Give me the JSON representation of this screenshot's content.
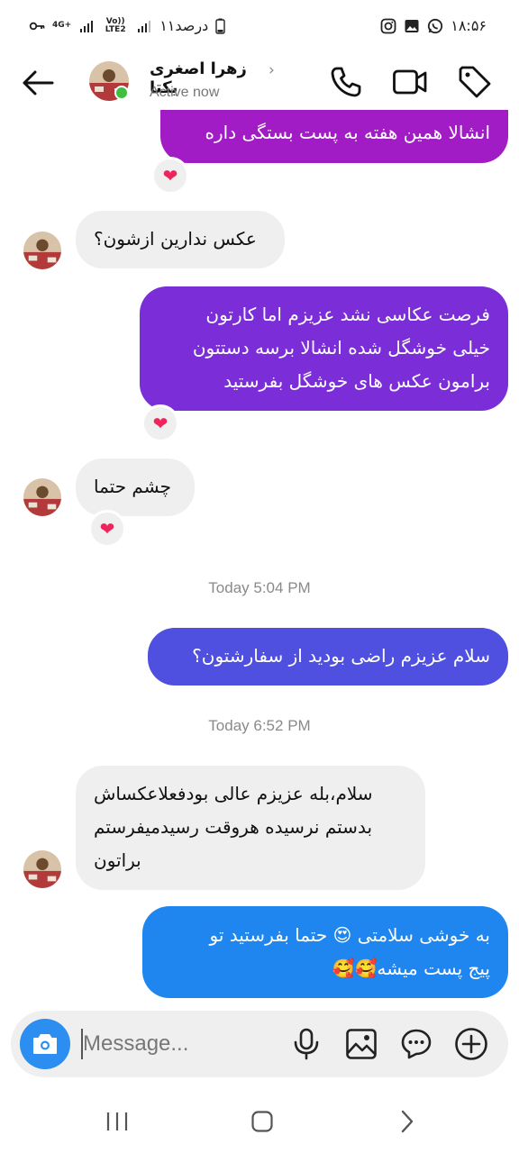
{
  "status_bar": {
    "time": "۱۸:۵۶",
    "battery": "۱۱درصد",
    "volte": "Vo)) LTE2",
    "network": "4G+"
  },
  "header": {
    "contact_name": "زهرا اصغری یکتا",
    "status": "Active now"
  },
  "messages": [
    {
      "id": "m1",
      "dir": "out",
      "text": "انشالا همین هفته به پست بستگی داره",
      "reaction": "❤"
    },
    {
      "id": "m2",
      "dir": "in",
      "text": "عکس ندارین ازشون؟"
    },
    {
      "id": "m3",
      "dir": "out",
      "lines": [
        "فرصت عکاسی نشد عزیزم اما کارتون",
        "خیلی خوشگل شده انشالا برسه دستتون",
        "برامون عکس های خوشگل بفرستید"
      ],
      "reaction": "❤"
    },
    {
      "id": "m4",
      "dir": "in",
      "text": "چشم حتما",
      "reaction": "❤"
    },
    {
      "id": "m5",
      "dir": "out",
      "text": "سلام عزیزم راضی بودید از سفارشتون؟"
    },
    {
      "id": "m6",
      "dir": "in",
      "lines": [
        "سلام،بله عزیزم عالی بودفعلاعکساش",
        "بدستم نرسیده هروقت رسیدمیفرستم",
        "براتون"
      ]
    },
    {
      "id": "m7",
      "dir": "out",
      "lines": [
        "به خوشی سلامتی 😍 حتما بفرستید تو",
        "پیج پست میشه🥰🥰"
      ]
    }
  ],
  "timestamps": [
    "Today 5:04 PM",
    "Today 6:52 PM"
  ],
  "composer": {
    "placeholder": "Message..."
  },
  "colors": {
    "bubble_purple": "#a11cc4",
    "bubble_violet": "#7b2ed8",
    "bubble_indigo": "#4f4fe0",
    "bubble_blue": "#1f86f0",
    "incoming": "#efefef",
    "online": "#3fbf3f"
  },
  "icons": [
    "back-arrow-icon",
    "phone-icon",
    "video-icon",
    "tag-icon",
    "camera-icon",
    "mic-icon",
    "gallery-icon",
    "sticker-icon",
    "add-icon",
    "recent-apps-icon",
    "home-icon",
    "nav-back-icon"
  ]
}
